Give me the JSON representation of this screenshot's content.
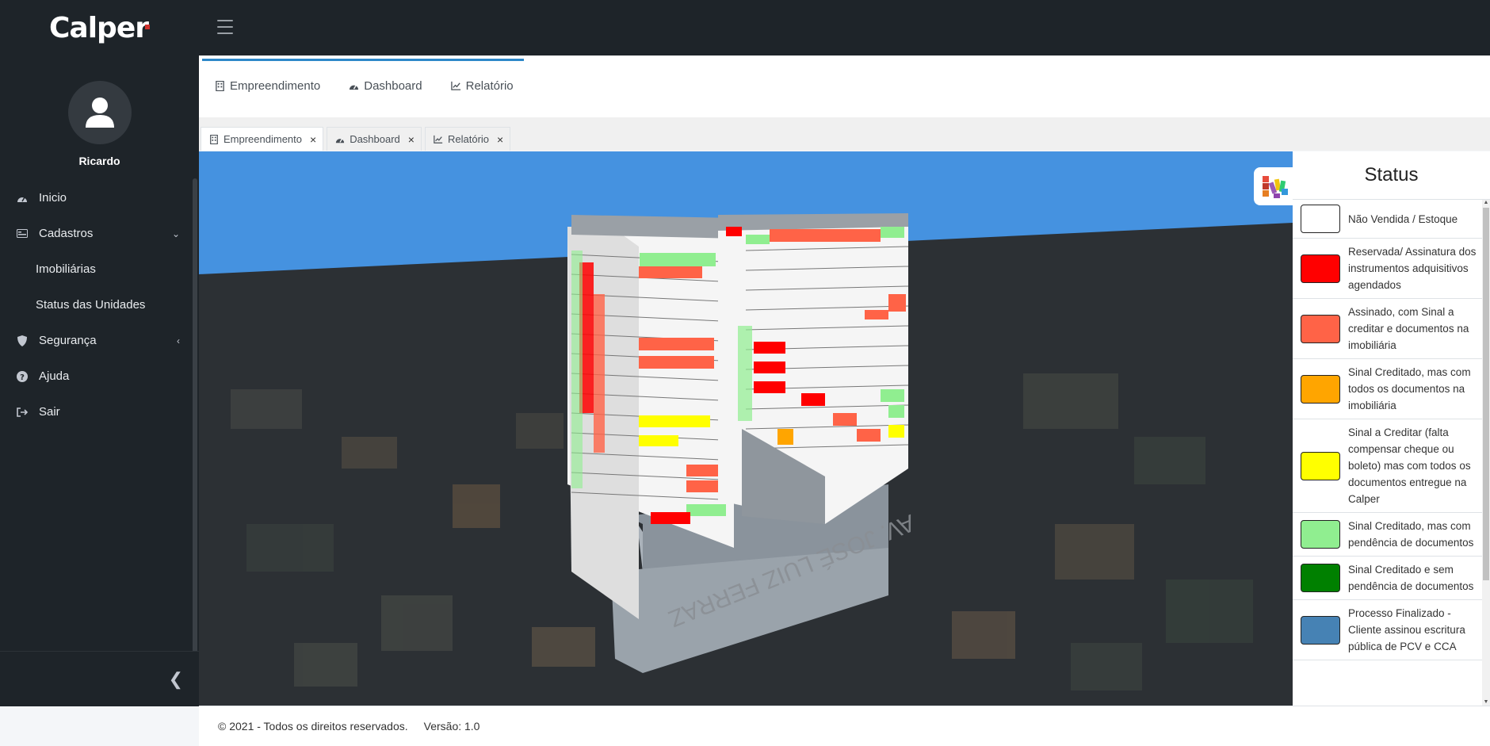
{
  "brand": {
    "name": "Calper"
  },
  "user": {
    "name": "Ricardo"
  },
  "sidebar": {
    "items": [
      {
        "label": "Inicio",
        "icon": "dashboard-icon"
      },
      {
        "label": "Cadastros",
        "icon": "id-card-icon"
      },
      {
        "label": "Imobiliárias"
      },
      {
        "label": "Status das Unidades"
      },
      {
        "label": "Segurança",
        "icon": "shield-icon"
      },
      {
        "label": "Ajuda",
        "icon": "help-icon"
      },
      {
        "label": "Sair",
        "icon": "sign-out-icon"
      }
    ]
  },
  "header_tabs": [
    {
      "label": "Empreendimento",
      "icon": "building-icon"
    },
    {
      "label": "Dashboard",
      "icon": "gauge-icon"
    },
    {
      "label": "Relatório",
      "icon": "chart-line-icon"
    }
  ],
  "open_tabs": [
    {
      "label": "Empreendimento",
      "close": "×"
    },
    {
      "label": "Dashboard",
      "close": "×"
    },
    {
      "label": "Relatório",
      "close": "×"
    }
  ],
  "scene": {
    "street_label": "AV. JOSÉ LUIZ FERRAZ"
  },
  "status": {
    "title": "Status",
    "items": [
      {
        "label": "Não Vendida / Estoque",
        "color": "#ffffff"
      },
      {
        "label": "Reservada/ Assinatura dos instrumentos adquisitivos agendados",
        "color": "#ff0000"
      },
      {
        "label": "Assinado, com Sinal a creditar e documentos na imobiliária",
        "color": "#ff6347"
      },
      {
        "label": "Sinal Creditado, mas com todos os documentos na imobiliária",
        "color": "#ffa500"
      },
      {
        "label": "Sinal a Creditar (falta compensar cheque ou boleto) mas com todos os documentos entregue na Calper",
        "color": "#ffff00"
      },
      {
        "label": "Sinal Creditado, mas com pendência de documentos",
        "color": "#90ee90"
      },
      {
        "label": "Sinal Creditado e sem pendência de documentos",
        "color": "#008000"
      },
      {
        "label": "Processo Finalizado - Cliente assinou escritura pública de PCV e CCA",
        "color": "#4682b4"
      }
    ]
  },
  "footer": {
    "copyright": "© 2021 - Todos os direitos reservados.",
    "version": "Versão: 1.0"
  }
}
